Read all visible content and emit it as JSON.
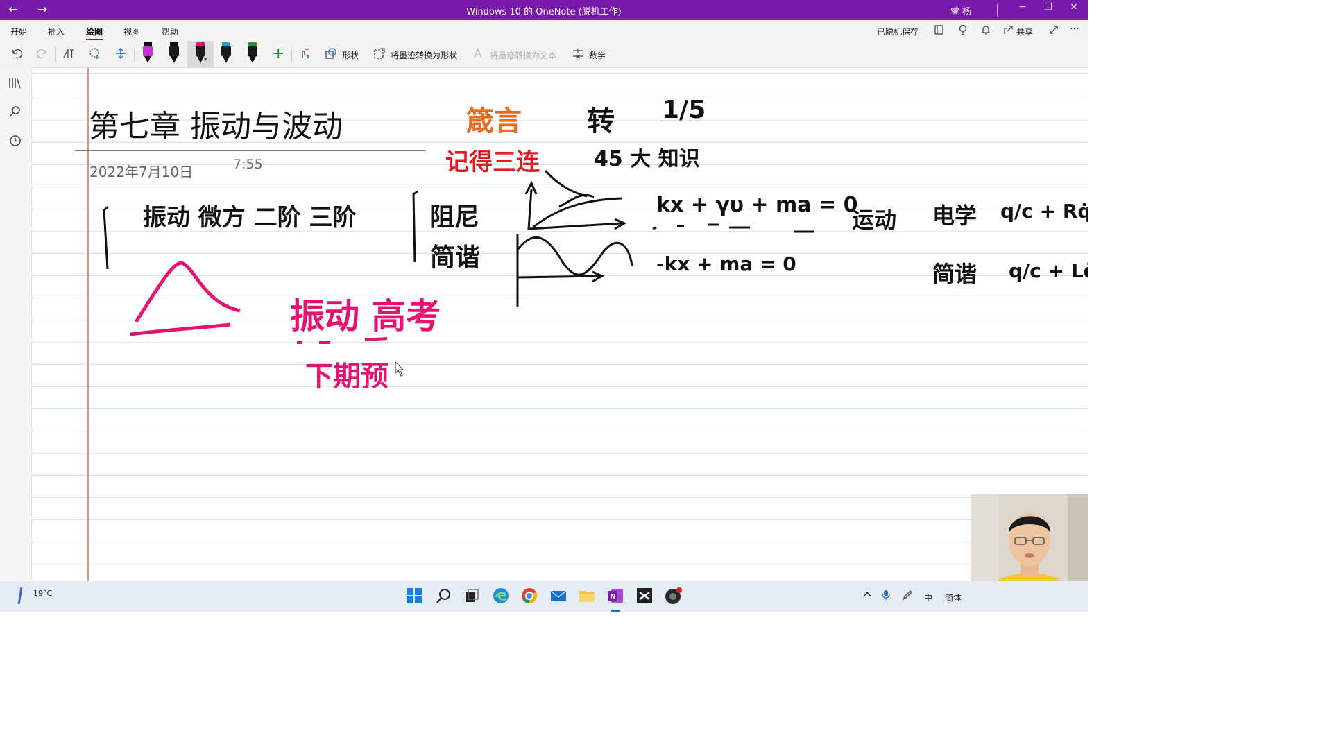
{
  "titlebar": {
    "back": "←",
    "forward": "→",
    "title": "Windows 10 的 OneNote (脱机工作)",
    "user": "睿 杨",
    "minimize": "─",
    "restore": "❐",
    "close": "✕"
  },
  "menu": {
    "items": [
      "开始",
      "插入",
      "绘图",
      "视图",
      "帮助"
    ],
    "active": "绘图",
    "offline_save": "已脱机保存",
    "share": "共享",
    "more": "···"
  },
  "toolbar": {
    "shapes": "形状",
    "ink_to_shape": "将墨迹转换为形状",
    "ink_to_text": "将墨迹转换为文本",
    "math": "数学",
    "pen_colors": [
      "#c62fd6",
      "#111111",
      "#e4136f",
      "#1aa3d8",
      "#1f9a3a"
    ]
  },
  "page": {
    "title": "第七章 振动与波动",
    "date": "2022年7月10日",
    "time": "7:55"
  },
  "ink": {
    "black": {
      "top_right_1": "转",
      "top_right_2": "1/5",
      "knowledge": "45 大 知识",
      "row1": "振动  微方  二阶  三阶",
      "damping": "阻尼",
      "simple_harmonic": "简谐",
      "eq1": "kx + γυ + ma = 0",
      "eq2": "-kx + ma = 0",
      "motion": "运动",
      "electricity": "电学",
      "q_frac": "q/c + Rq̇",
      "sh2": "简谐",
      "q_frac2": "q/c + Lq̈"
    },
    "orange": {
      "motto": "箴言"
    },
    "red": {
      "remember": "记得三连"
    },
    "pink": {
      "vibration_high": "振动 高考",
      "prep": "下期预"
    }
  },
  "taskbar": {
    "weather_temp": "19°C",
    "ime": "简体",
    "ime_mode": "中"
  }
}
